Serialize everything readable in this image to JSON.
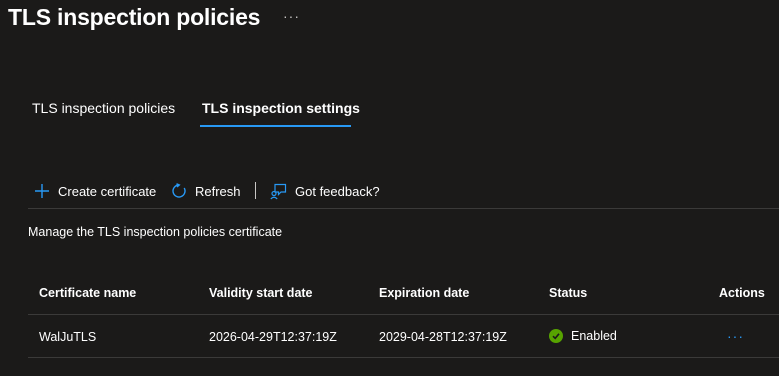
{
  "header": {
    "title": "TLS inspection policies",
    "more_label": "···"
  },
  "tabs": [
    {
      "label": "TLS inspection policies",
      "selected": false
    },
    {
      "label": "TLS inspection settings",
      "selected": true
    }
  ],
  "toolbar": {
    "create_label": "Create certificate",
    "create_icon": "plus-icon",
    "refresh_label": "Refresh",
    "refresh_icon": "refresh-icon",
    "feedback_label": "Got feedback?",
    "feedback_icon": "feedback-icon"
  },
  "description": "Manage the TLS inspection policies certificate",
  "table": {
    "columns": [
      "Certificate name",
      "Validity start date",
      "Expiration date",
      "Status",
      "Actions"
    ],
    "rows": [
      {
        "name": "WalJuTLS",
        "start": "2026-04-29T12:37:19Z",
        "expiration": "2029-04-28T12:37:19Z",
        "status": "Enabled",
        "status_icon": "check-circle-icon",
        "actions": "···"
      }
    ]
  },
  "colors": {
    "background": "#1b1a19",
    "accent": "#2899f5",
    "success": "#57a300"
  }
}
